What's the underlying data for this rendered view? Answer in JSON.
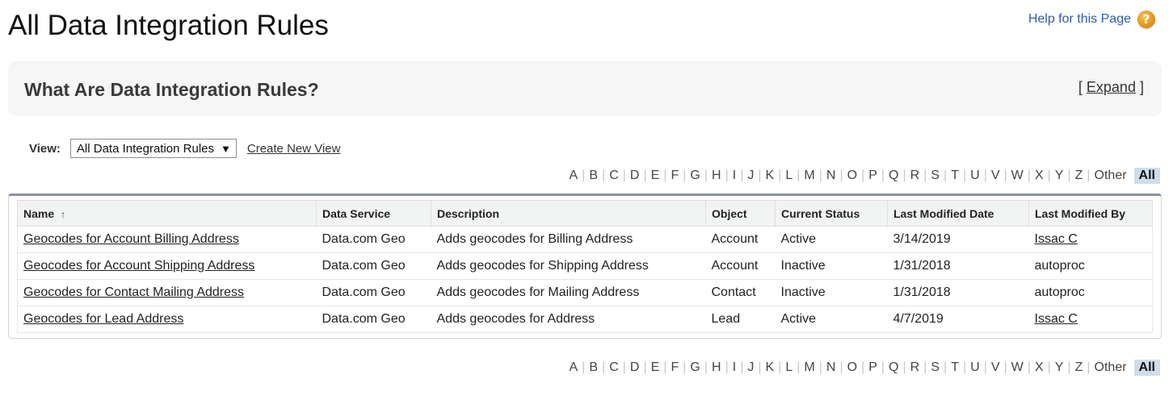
{
  "page": {
    "title": "All Data Integration Rules",
    "help_label": "Help for this Page",
    "help_icon": "help-icon"
  },
  "info": {
    "title": "What Are Data Integration Rules?",
    "expand_open": "[",
    "expand_label": "Expand",
    "expand_close": "]"
  },
  "view": {
    "label": "View:",
    "selected": "All Data Integration Rules",
    "dropdown_glyph": "▼",
    "create_label": "Create New View"
  },
  "alpha": {
    "letters": [
      "A",
      "B",
      "C",
      "D",
      "E",
      "F",
      "G",
      "H",
      "I",
      "J",
      "K",
      "L",
      "M",
      "N",
      "O",
      "P",
      "Q",
      "R",
      "S",
      "T",
      "U",
      "V",
      "W",
      "X",
      "Y",
      "Z",
      "Other"
    ],
    "all_label": "All"
  },
  "table": {
    "columns": [
      "Name",
      "Data Service",
      "Description",
      "Object",
      "Current Status",
      "Last Modified Date",
      "Last Modified By"
    ],
    "sort_glyph": "↑",
    "rows": [
      {
        "name": "Geocodes for Account Billing Address",
        "service": "Data.com Geo",
        "description": "Adds geocodes for Billing Address",
        "object": "Account",
        "status": "Active",
        "date": "3/14/2019",
        "by": "Issac C",
        "by_link": true
      },
      {
        "name": "Geocodes for Account Shipping Address",
        "service": "Data.com Geo",
        "description": "Adds geocodes for Shipping Address",
        "object": "Account",
        "status": "Inactive",
        "date": "1/31/2018",
        "by": "autoproc",
        "by_link": false
      },
      {
        "name": "Geocodes for Contact Mailing Address",
        "service": "Data.com Geo",
        "description": "Adds geocodes for Mailing Address",
        "object": "Contact",
        "status": "Inactive",
        "date": "1/31/2018",
        "by": "autoproc",
        "by_link": false
      },
      {
        "name": "Geocodes for Lead Address",
        "service": "Data.com Geo",
        "description": "Adds geocodes for Address",
        "object": "Lead",
        "status": "Active",
        "date": "4/7/2019",
        "by": "Issac C",
        "by_link": true
      }
    ]
  }
}
